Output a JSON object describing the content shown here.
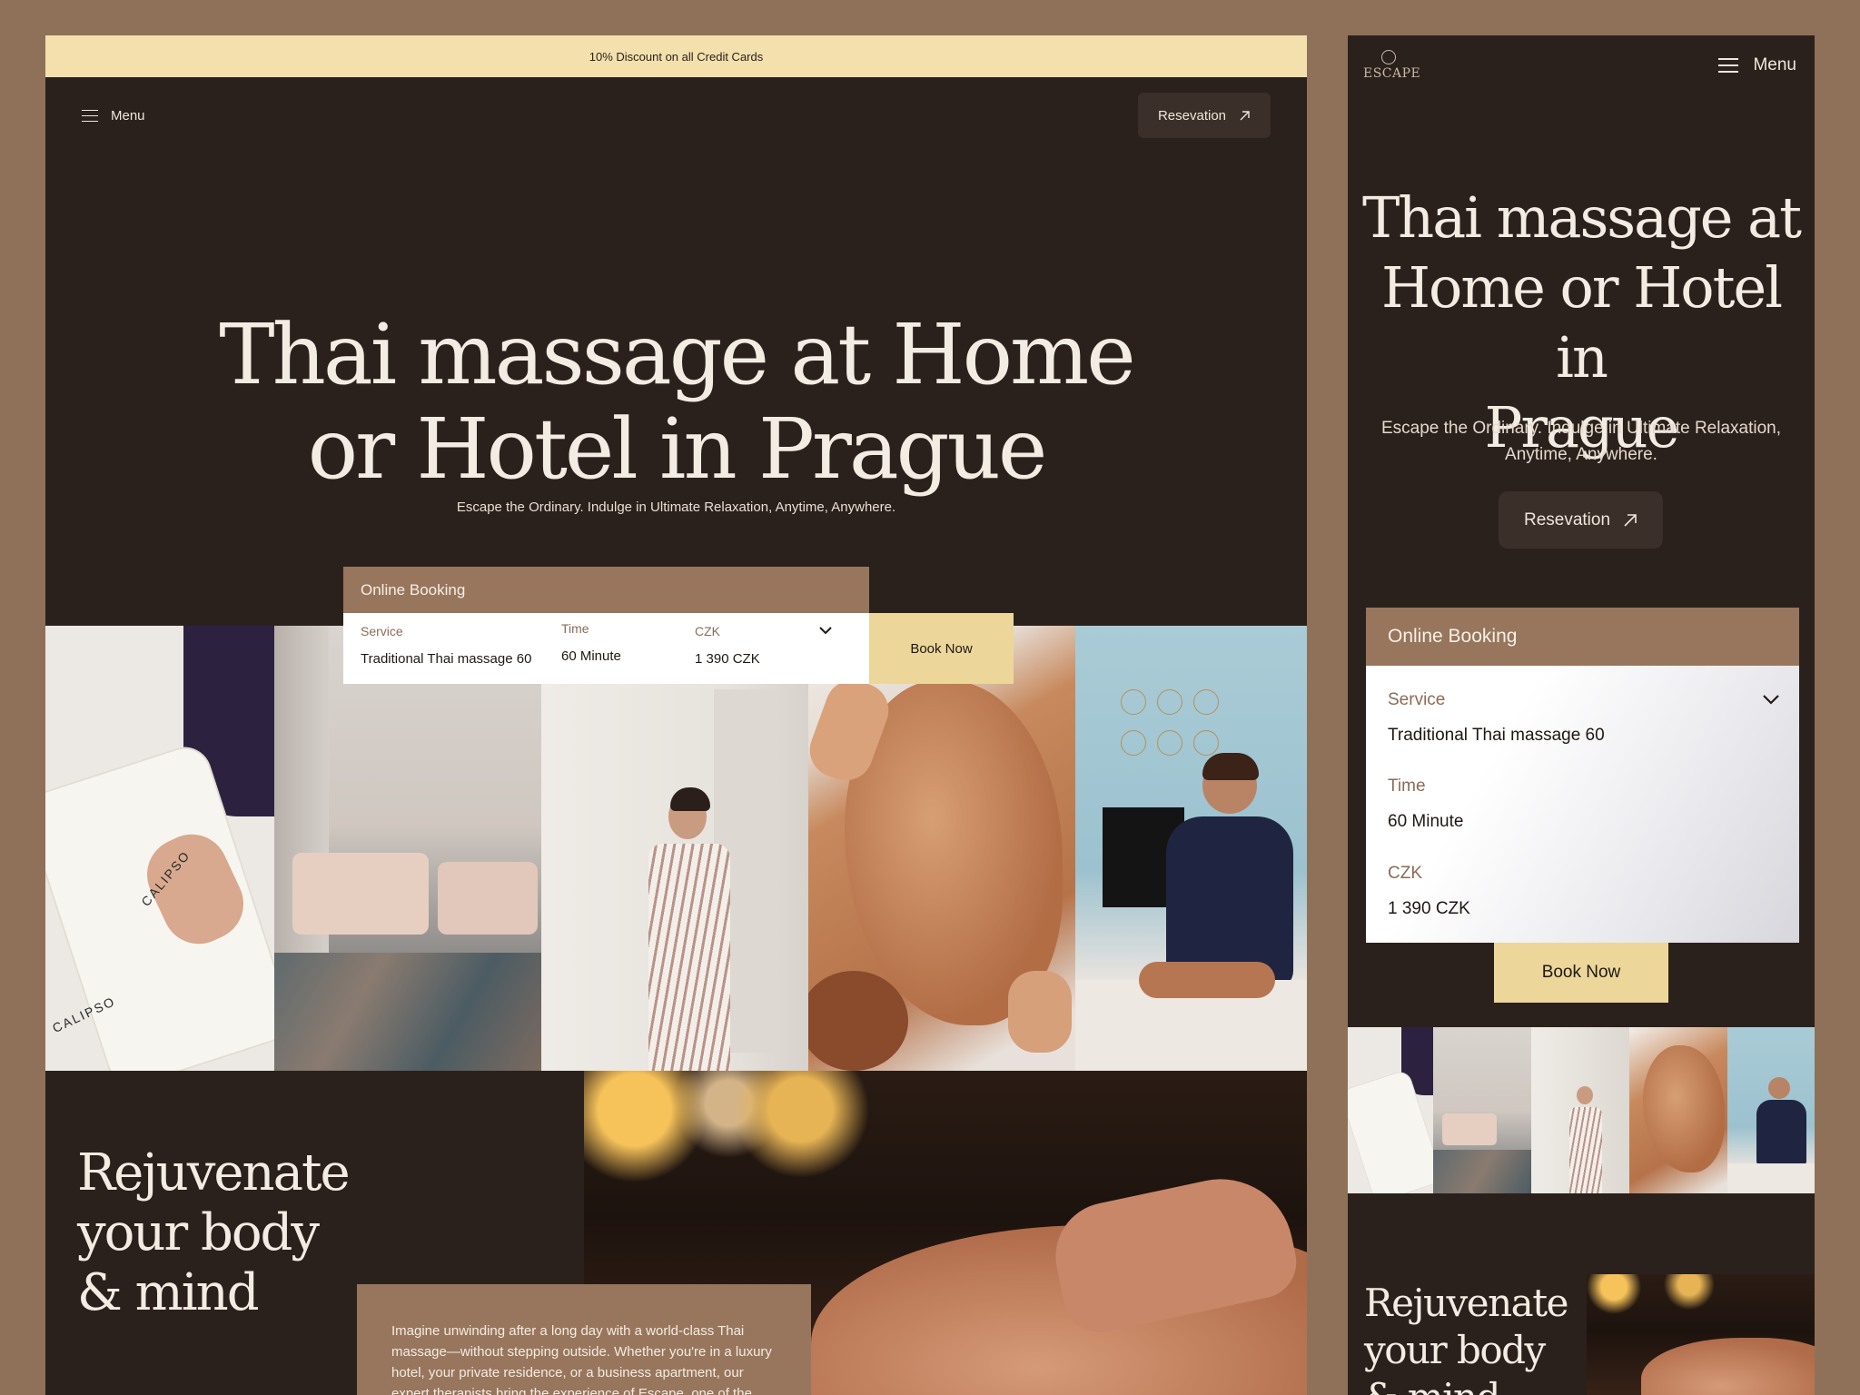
{
  "promo": {
    "text": "10% Discount on all Credit Cards"
  },
  "nav": {
    "menu_label": "Menu",
    "reservation_label": "Resevation"
  },
  "hero": {
    "title_line1": "Thai massage at Home",
    "title_line2": "or Hotel in Prague",
    "subtitle": "Escape the Ordinary. Indulge in Ultimate Relaxation, Anytime, Anywhere."
  },
  "booking": {
    "heading": "Online Booking",
    "service_label": "Service",
    "service_value": "Traditional Thai massage 60",
    "time_label": "Time",
    "time_value": "60 Minute",
    "price_label": "CZK",
    "price_value": "1 390 CZK",
    "book_button": "Book Now"
  },
  "photos": {
    "towel_brand": "CALIPSO"
  },
  "section": {
    "rejuv_line1": "Rejuvenate",
    "rejuv_line2": "your body",
    "rejuv_line3": "& mind",
    "about_text": "Imagine unwinding after a long day with a world-class Thai massage—without stepping outside. Whether you're in a luxury hotel, your private residence, or a business apartment, our expert therapists bring the experience of Escape, one of the"
  },
  "mobile": {
    "logo_text": "ESCAPE",
    "menu_label": "Menu",
    "title_line1": "Thai massage at",
    "title_line2": "Home or Hotel in",
    "title_line3": "Prague",
    "subtitle_line1": "Escape the Ordinary. Indulge in Ultimate Relaxation,",
    "subtitle_line2": "Anytime, Anywhere.",
    "reservation_label": "Resevation"
  },
  "colors": {
    "background": "#8f7159",
    "panel": "#2b211c",
    "promo_bar": "#f4e0ad",
    "booking_head": "#97765d",
    "book_button": "#ecd69a"
  }
}
